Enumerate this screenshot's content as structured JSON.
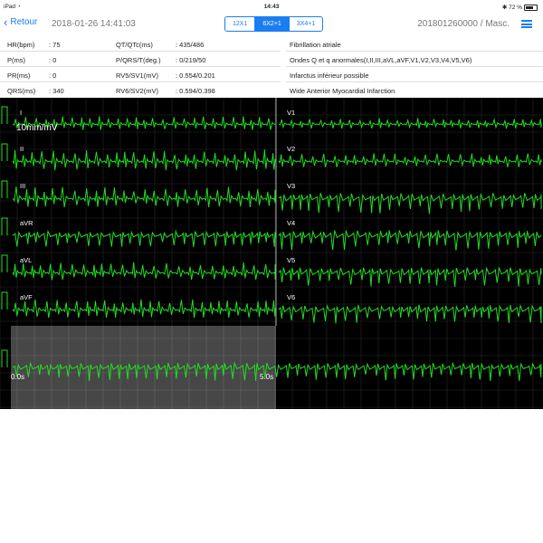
{
  "status": {
    "device": "iPad",
    "time": "14:43",
    "battery": "72 %"
  },
  "nav": {
    "back_label": "Retour",
    "datetime": "2018-01-26 14:41:03",
    "segments": [
      "12X1",
      "6X2+1",
      "3X4+1"
    ],
    "active_segment": "6X2+1",
    "patient": "201801260000 / Masc."
  },
  "measurements": [
    {
      "label": "HR(bpm)",
      "value": ": 75",
      "label2": "QT/QTc(ms)",
      "value2": ": 435/486",
      "diagnosis": "Fibrillation atriale"
    },
    {
      "label": "P(ms)",
      "value": ": 0",
      "label2": "P/QRS/T(deg.)",
      "value2": ": 0/219/50",
      "diagnosis": "Ondes Q et q anormales(I,II,III,aVL,aVF,V1,V2,V3,V4,V5,V6)"
    },
    {
      "label": "PR(ms)",
      "value": ": 0",
      "label2": "RV5/SV1(mV)",
      "value2": ": 0.554/0.201",
      "diagnosis": "Infarctus inférieur possible"
    },
    {
      "label": "QRS(ms)",
      "value": ": 340",
      "label2": "RV6/SV2(mV)",
      "value2": ": 0.594/0.398",
      "diagnosis": "Wide Anterior Myocardial Infarction"
    }
  ],
  "ecg": {
    "scale_label": "10mm/mV",
    "time_start": "0.0s",
    "time_end": "5.0s",
    "left_leads": [
      "I",
      "II",
      "III",
      "aVR",
      "aVL",
      "aVF"
    ],
    "right_leads": [
      "V1",
      "V2",
      "V3",
      "V4",
      "V5",
      "V6"
    ],
    "rhythm_lead": "II",
    "trace_color": "#22dd22",
    "grid_color": "#2a2a2a"
  }
}
